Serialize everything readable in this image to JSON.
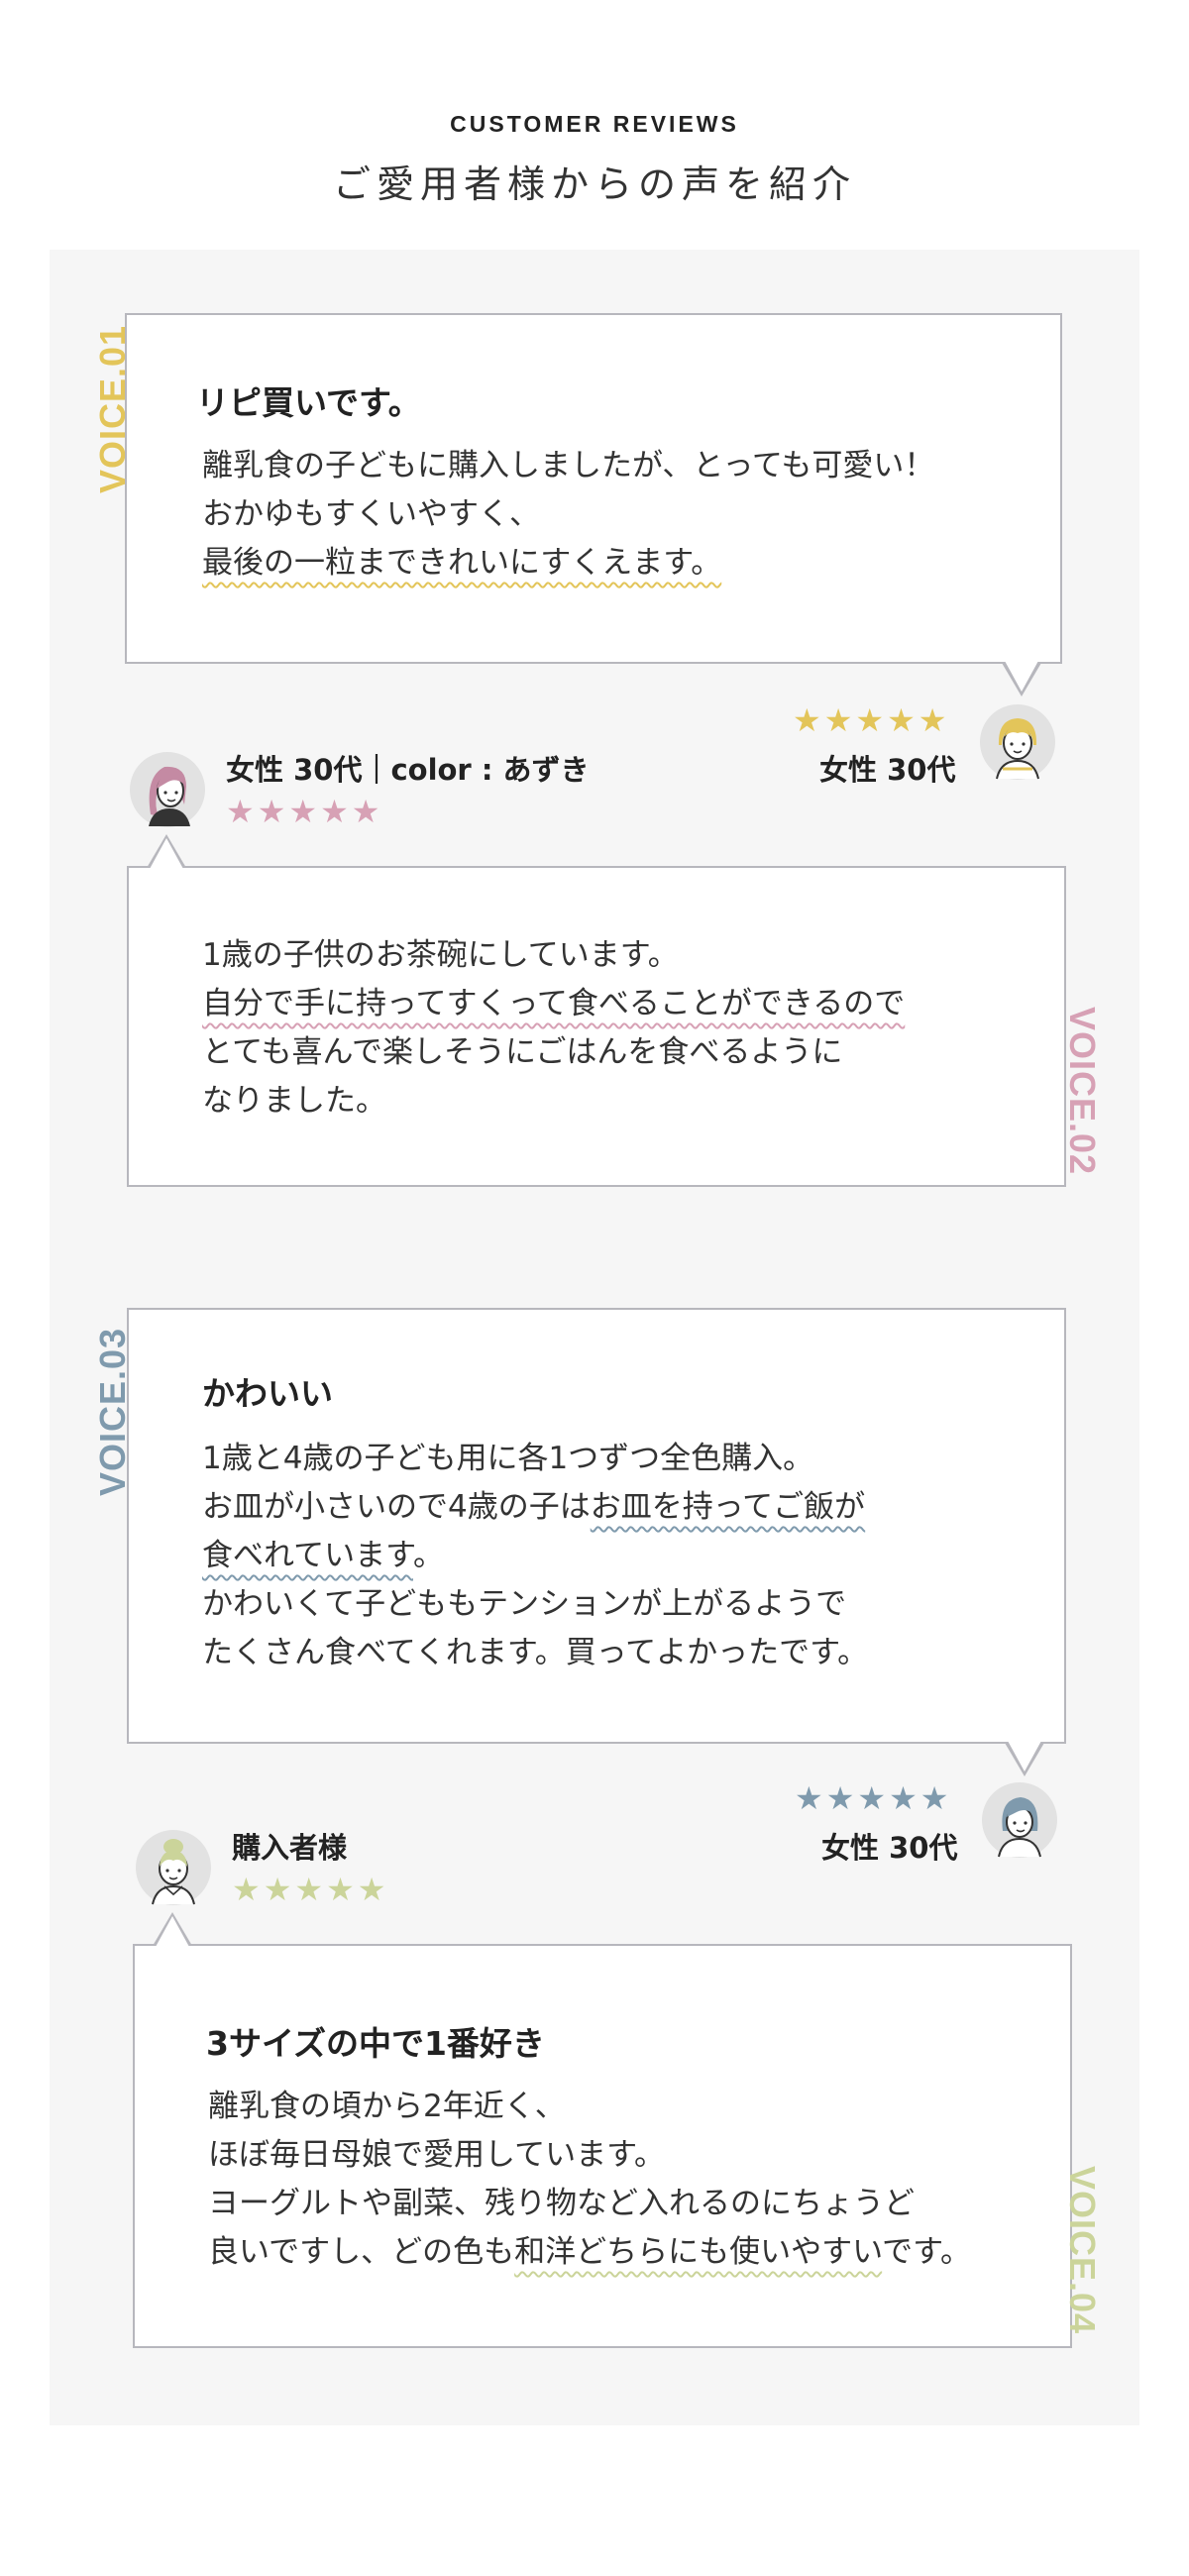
{
  "header": {
    "eyebrow": "CUSTOMER REVIEWS",
    "title": "ご愛用者様からの声を紹介"
  },
  "star_glyph": "★★★★★",
  "colors": {
    "voice01": "#e3c55a",
    "voice02": "#d7a1b5",
    "voice03": "#7f9aad",
    "voice04": "#cbd49a",
    "panel_bg": "#f6f6f6",
    "bubble_border": "#b7b7bd"
  },
  "reviews": [
    {
      "voice_label": "VOICE.01",
      "title": "リピ買いです。",
      "lines": [
        "離乳食の子どもに購入しましたが、とっても可愛い！",
        "おかゆもすくいやすく、"
      ],
      "underlined": "最後の一粒まできれいにすくえます。",
      "reviewer": "女性 30代",
      "rating": 5,
      "avatar_icon": "woman-short-hair-avatar-icon"
    },
    {
      "voice_label": "VOICE.02",
      "line1": "1歳の子供のお茶碗にしています。",
      "underlined": "自分で手に持ってすくって食べることができるので",
      "lines": [
        "とても喜んで楽しそうにごはんを食べるように",
        "なりました。"
      ],
      "reviewer": "女性 30代｜color : あずき",
      "rating": 5,
      "avatar_icon": "woman-long-hair-avatar-icon"
    },
    {
      "voice_label": "VOICE.03",
      "title": "かわいい",
      "line1": "1歳と4歳の子ども用に各1つずつ全色購入。",
      "line2_plain": "お皿が小さいので4歳の子は",
      "line2_underlined": "お皿を持ってご飯が",
      "line3_underlined": "食べれています",
      "line3_plain": "。",
      "lines": [
        "かわいくて子どももテンションが上がるようで",
        "たくさん食べてくれます。買ってよかったです。"
      ],
      "reviewer": "女性 30代",
      "rating": 5,
      "avatar_icon": "woman-bob-hair-avatar-icon"
    },
    {
      "voice_label": "VOICE.04",
      "title": "3サイズの中で1番好き",
      "lines": [
        "離乳食の頃から2年近く、",
        "ほぼ毎日母娘で愛用しています。",
        "ヨーグルトや副菜、残り物など入れるのにちょうど"
      ],
      "line4_plain_a": "良いですし、どの色も",
      "line4_underlined": "和洋どちらにも使いやすい",
      "line4_plain_b": "です。",
      "reviewer": "購入者様",
      "rating": 5,
      "avatar_icon": "woman-updo-avatar-icon"
    }
  ]
}
